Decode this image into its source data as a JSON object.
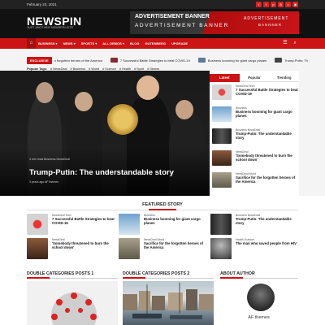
{
  "topbar": {
    "date": "February 23, 2021",
    "social_icons": [
      "facebook-icon",
      "twitter-icon",
      "pinterest-icon",
      "instagram-icon",
      "vimeo-icon",
      "rss-icon"
    ]
  },
  "header": {
    "logo": "NEWSPIN",
    "tagline": "JUST ANOTHER NEWSPIN SITE"
  },
  "ad": {
    "left_line1": "ADVERTISEMENT BANNER",
    "left_line2": "ADVERTISEMENT BANNER",
    "right_line1": "ADVERTISEMENT",
    "right_line2": "BANNNER"
  },
  "nav": {
    "items": [
      "BUSINESS ▾",
      "NEWS ▾",
      "SPORTS ▾",
      "ALL DEMOS ▾",
      "BLOG",
      "GUTENBERG",
      "UPGRADE"
    ]
  },
  "ticker": {
    "label": "EXCLUSIVE",
    "items": [
      "n forgotten heroes of the America",
      "7 Successful Battle Strategies to beat COVID-19",
      "Business booming for giant cargo planes",
      "Trump-Putin: Th"
    ]
  },
  "popular": {
    "label": "Popular Tags:",
    "tags": [
      "# NewsDeal",
      "# Business",
      "# World",
      "# Science",
      "# Health",
      "# Sport",
      "# Stories"
    ]
  },
  "hero": {
    "tags": "3 min read   Business   NewsDeal",
    "title": "Trump-Putin: The understandable story",
    "meta": "3 years ago   AF themes"
  },
  "sidebar": {
    "tabs": [
      "Latest",
      "Popular",
      "Trending"
    ],
    "items": [
      {
        "cat": "NewsDeal   Tech",
        "title": "7 Successful Battle Strategies to beat COVID-19"
      },
      {
        "cat": "Business",
        "title": "Business booming for giant cargo planes"
      },
      {
        "cat": "Business   NewsDeal",
        "title": "Trump-Putin: The understandable story"
      },
      {
        "cat": "NewsDeal",
        "title": "'Somebody threatened to burn the school down'"
      },
      {
        "cat": "NewsDeal   World",
        "title": "Sacrifice for the forgotten heroes of the America"
      }
    ]
  },
  "featured": {
    "heading": "FEATURED STORY",
    "items": [
      {
        "cat": "NewsDeal   Tech",
        "title": "7 Successful Battle Strategies to beat COVID-19"
      },
      {
        "cat": "Business",
        "title": "Business booming for giant cargo planes"
      },
      {
        "cat": "Business   NewsDeal",
        "title": "Trump-Putin: The understandable story"
      },
      {
        "cat": "NewsDeal",
        "title": "'Somebody threatened to burn the school down'"
      },
      {
        "cat": "NewsDeal   World",
        "title": "Sacrifice for the forgotten heroes of the America"
      },
      {
        "cat": "Health   Science",
        "title": "The man who saved people from HIV"
      }
    ]
  },
  "sections": {
    "dc1": "DOUBLE CATEGORIES POSTS 1",
    "dc2": "DOUBLE CATEGORIES POSTS 2",
    "about": "ABOUT AUTHOR"
  },
  "author": {
    "name": "AF themes"
  },
  "colors": {
    "accent": "#cc1414",
    "dark": "#111111"
  }
}
